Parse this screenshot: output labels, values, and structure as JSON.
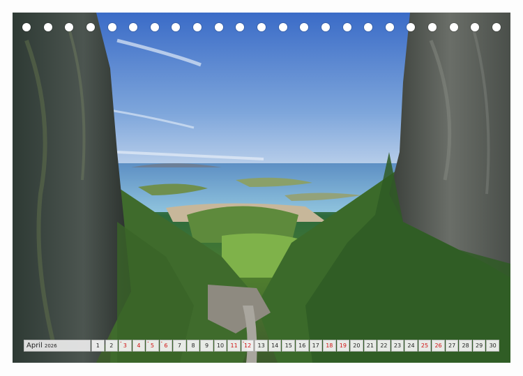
{
  "calendar": {
    "month": "April",
    "year": "2026",
    "holes_count": 23,
    "days": [
      {
        "n": "1",
        "red": false,
        "mark": ""
      },
      {
        "n": "2",
        "red": false,
        "mark": ""
      },
      {
        "n": "3",
        "red": true,
        "mark": "•"
      },
      {
        "n": "4",
        "red": true,
        "mark": ""
      },
      {
        "n": "5",
        "red": true,
        "mark": "•"
      },
      {
        "n": "6",
        "red": true,
        "mark": "•"
      },
      {
        "n": "7",
        "red": false,
        "mark": ""
      },
      {
        "n": "8",
        "red": false,
        "mark": ""
      },
      {
        "n": "9",
        "red": false,
        "mark": ""
      },
      {
        "n": "10",
        "red": false,
        "mark": ""
      },
      {
        "n": "11",
        "red": true,
        "mark": ""
      },
      {
        "n": "12",
        "red": true,
        "mark": "•"
      },
      {
        "n": "13",
        "red": false,
        "mark": ""
      },
      {
        "n": "14",
        "red": false,
        "mark": ""
      },
      {
        "n": "15",
        "red": false,
        "mark": ""
      },
      {
        "n": "16",
        "red": false,
        "mark": ""
      },
      {
        "n": "17",
        "red": false,
        "mark": ""
      },
      {
        "n": "18",
        "red": true,
        "mark": ""
      },
      {
        "n": "19",
        "red": true,
        "mark": ""
      },
      {
        "n": "20",
        "red": false,
        "mark": ""
      },
      {
        "n": "21",
        "red": false,
        "mark": ""
      },
      {
        "n": "22",
        "red": false,
        "mark": ""
      },
      {
        "n": "23",
        "red": false,
        "mark": ""
      },
      {
        "n": "24",
        "red": false,
        "mark": ""
      },
      {
        "n": "25",
        "red": true,
        "mark": ""
      },
      {
        "n": "26",
        "red": true,
        "mark": ""
      },
      {
        "n": "27",
        "red": false,
        "mark": ""
      },
      {
        "n": "28",
        "red": false,
        "mark": ""
      },
      {
        "n": "29",
        "red": false,
        "mark": ""
      },
      {
        "n": "30",
        "red": false,
        "mark": ""
      }
    ]
  }
}
